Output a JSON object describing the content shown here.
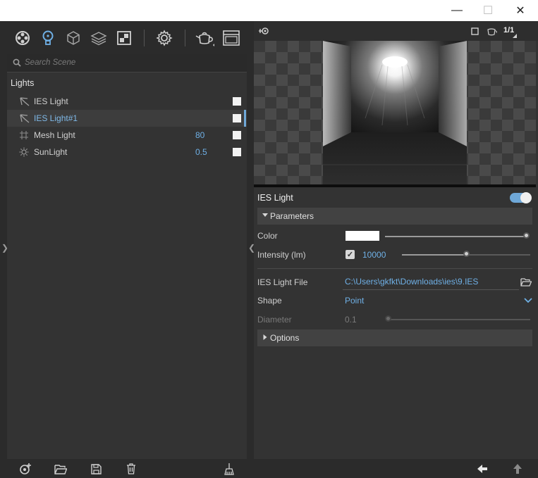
{
  "window": {
    "minimize_glyph": "—",
    "maximize_glyph": "☐",
    "close_glyph": "✕"
  },
  "toolbar": {
    "icons": [
      "material-ball-icon",
      "lightbulb-icon",
      "cube-icon",
      "layers-icon",
      "checker-icon",
      "gear-icon",
      "teapot-icon",
      "window-icon"
    ]
  },
  "scene": {
    "search_placeholder": "Search Scene",
    "section_title": "Lights",
    "lights": [
      {
        "name": "IES Light",
        "value": "",
        "icon": "ies-light-icon",
        "selected": false
      },
      {
        "name": "IES Light#1",
        "value": "",
        "icon": "ies-light-icon",
        "selected": true
      },
      {
        "name": "Mesh Light",
        "value": "80",
        "icon": "mesh-light-icon",
        "selected": false
      },
      {
        "name": "SunLight",
        "value": "0.5",
        "icon": "sun-icon",
        "selected": false
      }
    ]
  },
  "viewport": {
    "resolution_label": "1/1"
  },
  "properties": {
    "title": "IES Light",
    "enabled": true,
    "parameters_label": "Parameters",
    "color_label": "Color",
    "color_value": "#ffffff",
    "color_slider_level": 1.0,
    "intensity_label": "Intensity (lm)",
    "intensity_value": "10000",
    "intensity_slider_level": 0.5,
    "ies_file_label": "IES Light File",
    "ies_file_value": "C:\\Users\\gkfkt\\Downloads\\ies\\9.IES",
    "shape_label": "Shape",
    "shape_value": "Point",
    "diameter_label": "Diameter",
    "diameter_value": "0.1",
    "diameter_slider_level": 0.0,
    "options_label": "Options"
  },
  "colors": {
    "accent": "#6fb0e6",
    "panel": "#333333",
    "background": "#2b2b2b"
  }
}
